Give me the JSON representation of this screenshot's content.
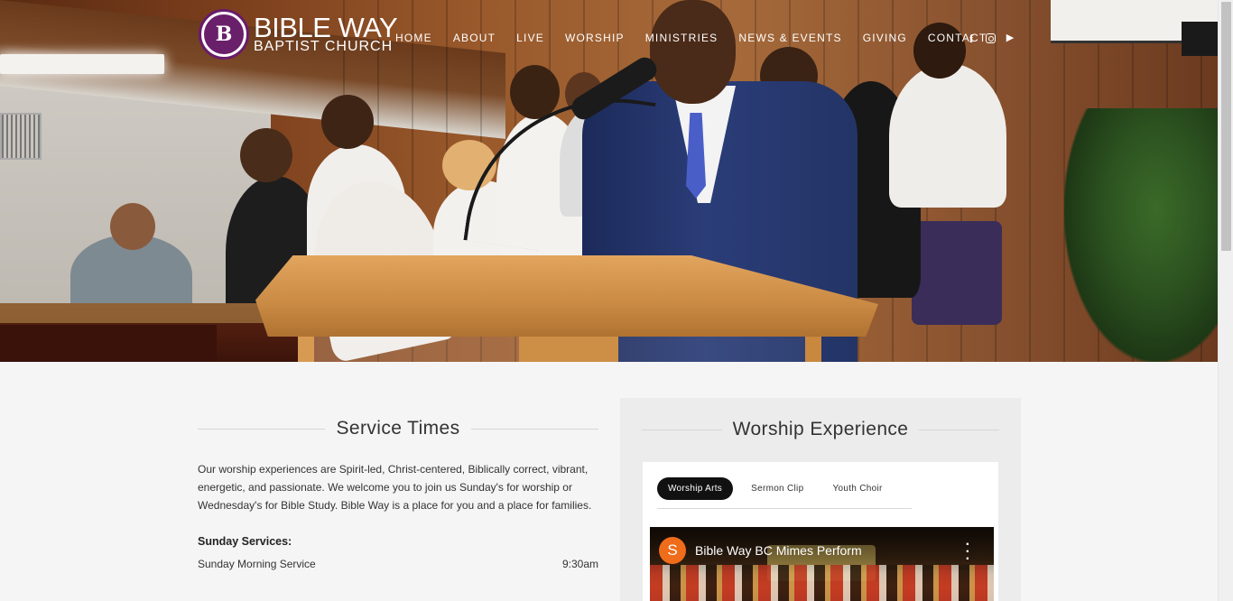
{
  "brand": {
    "name_line1": "BIBLE WAY",
    "name_line2": "BAPTIST CHURCH",
    "logo_letter": "B",
    "color": "#6a1f6a"
  },
  "nav": {
    "items": [
      "HOME",
      "ABOUT",
      "LIVE",
      "WORSHIP",
      "MINISTRIES",
      "NEWS & EVENTS",
      "GIVING",
      "CONTACT"
    ]
  },
  "social": {
    "facebook": "f",
    "instagram_icon": "instagram-icon",
    "youtube": "▶"
  },
  "service_times": {
    "title": "Service Times",
    "description": "Our worship experiences are Spirit-led, Christ-centered, Biblically  correct, vibrant, energetic, and passionate. We welcome you to join us  Sunday's for worship or Wednesday's for Bible Study. Bible Way is a  place for you and a place for families.",
    "sunday_title": "Sunday Services:",
    "rows": [
      {
        "label": "Sunday Morning Service",
        "time": "9:30am"
      }
    ]
  },
  "worship_experience": {
    "title": "Worship Experience",
    "tabs": [
      "Worship Arts",
      "Sermon Clip",
      "Youth Choir"
    ],
    "active_tab": 0,
    "video": {
      "channel_initial": "S",
      "channel_color": "#ef6c1a",
      "title": "Bible Way BC Mimes Perform"
    }
  }
}
